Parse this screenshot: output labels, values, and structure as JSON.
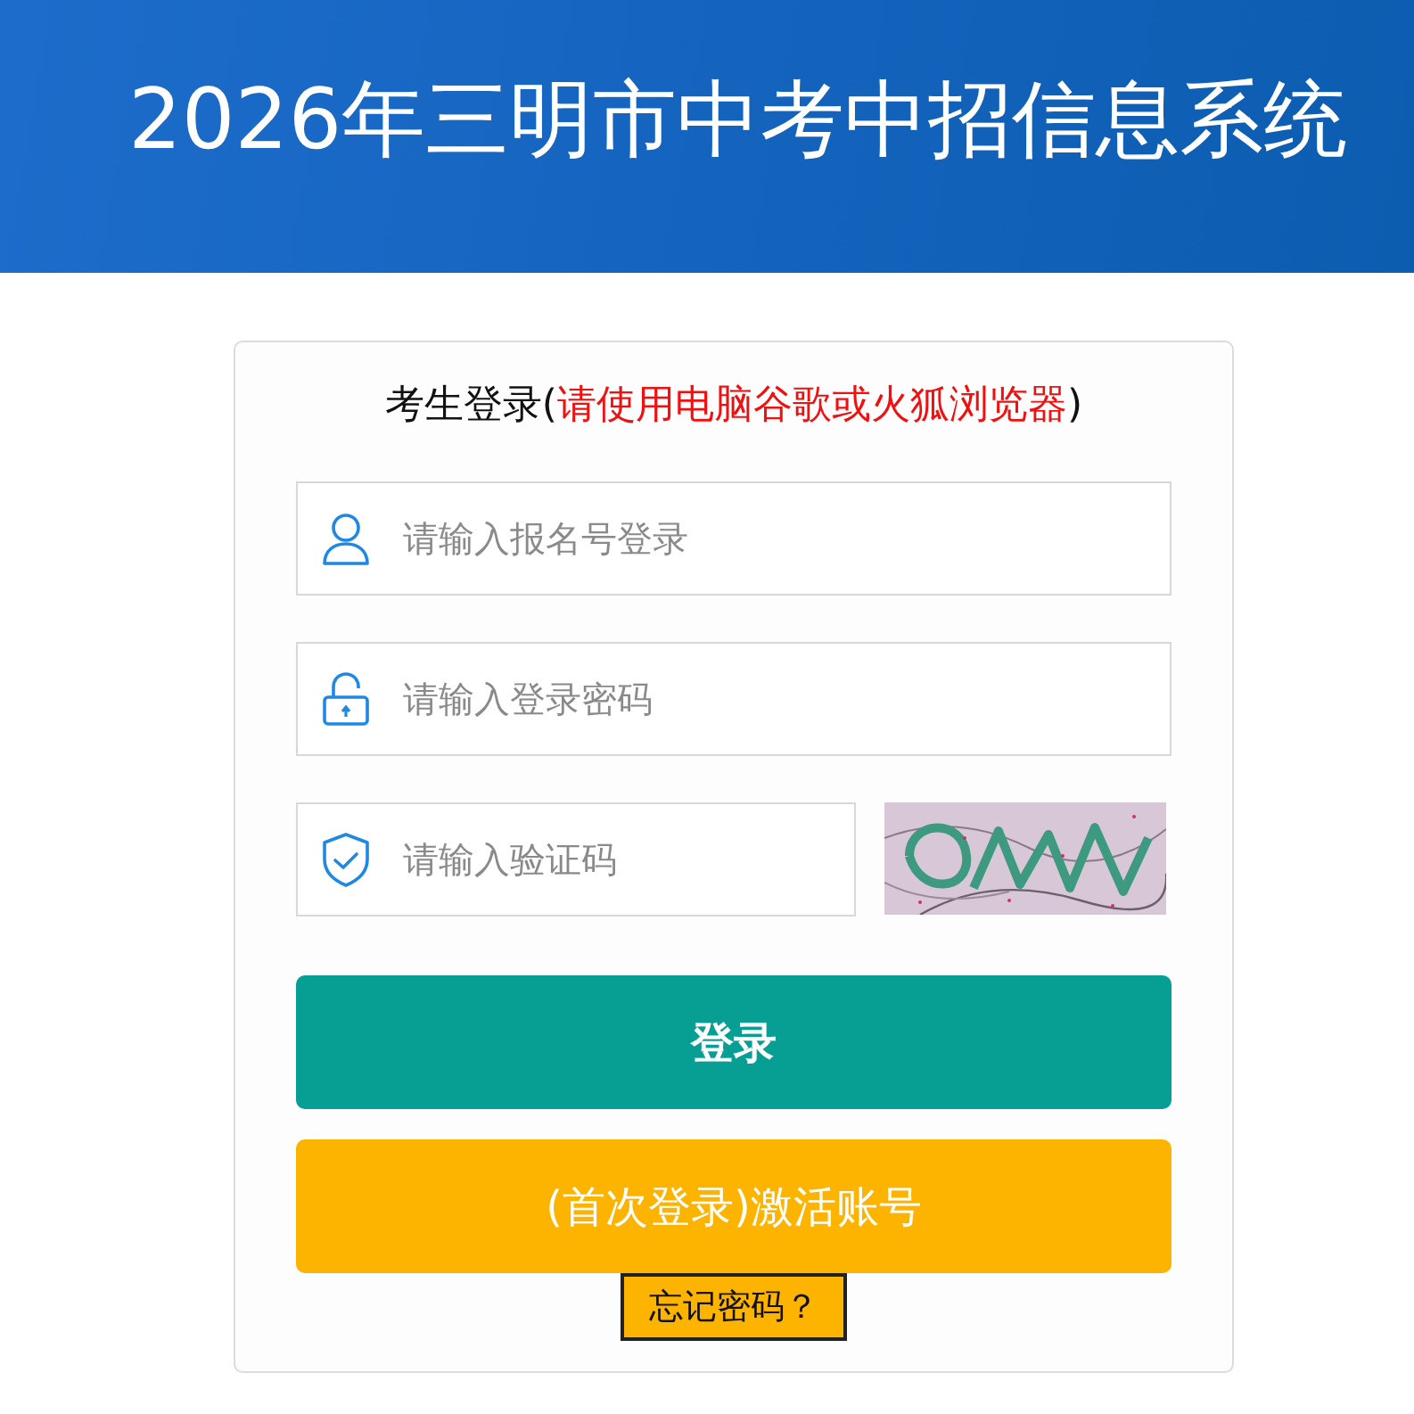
{
  "header": {
    "title": "2026年三明市中考中招信息系统"
  },
  "login": {
    "heading": [
      {
        "kind": "plain",
        "text": "考生登录("
      },
      {
        "kind": "warning",
        "text": "请使用电脑谷歌或火狐浏览器"
      },
      {
        "kind": "plain",
        "text": ")"
      }
    ],
    "fields": [
      {
        "kind": "user",
        "placeholder": "请输入报名号登录"
      },
      {
        "kind": "password",
        "placeholder": "请输入登录密码"
      },
      {
        "kind": "captcha",
        "placeholder": "请输入验证码"
      }
    ],
    "buttons": [
      {
        "kind": "primary",
        "label": "登录"
      },
      {
        "kind": "secondary",
        "label": "(首次登录)激活账号"
      }
    ],
    "forgot_link": "忘记密码？"
  }
}
